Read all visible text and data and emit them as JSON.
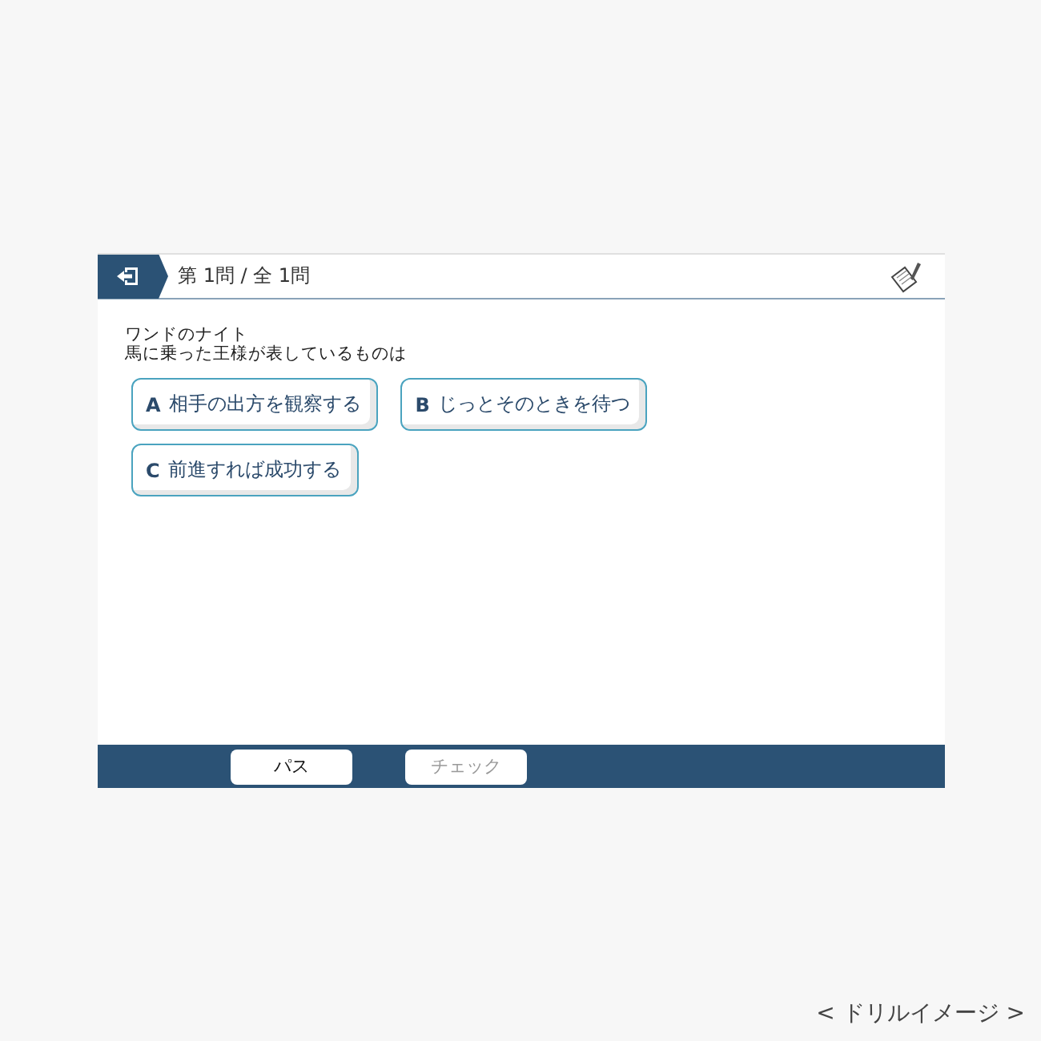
{
  "header": {
    "title": "第 1問 / 全 1問"
  },
  "question": {
    "lines": [
      "ワンドのナイト",
      "馬に乗った王様が表しているものは"
    ]
  },
  "options": [
    {
      "letter": "A",
      "text": "相手の出方を観察する"
    },
    {
      "letter": "B",
      "text": "じっとそのときを待つ"
    },
    {
      "letter": "C",
      "text": "前進すれば成功する"
    }
  ],
  "footer_buttons": [
    {
      "label": "パス",
      "disabled": false
    },
    {
      "label": "チェック",
      "disabled": true
    }
  ],
  "caption": "< ドリルイメージ >"
}
